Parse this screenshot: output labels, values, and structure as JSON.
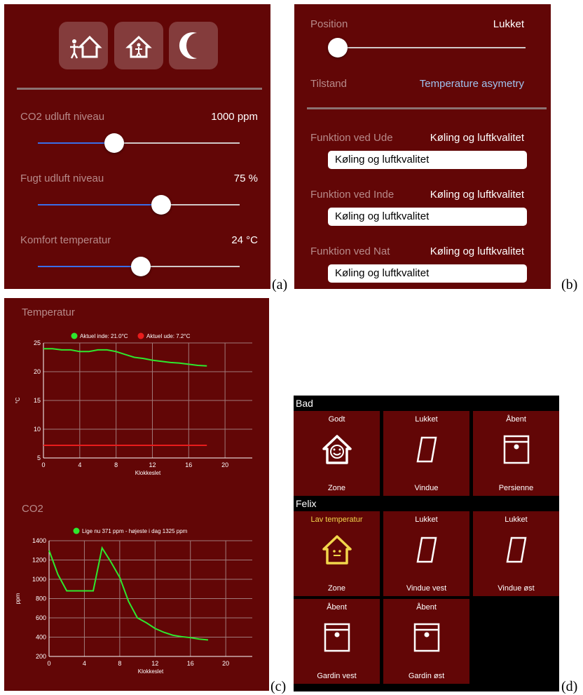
{
  "captions": {
    "a": "(a)",
    "b": "(b)",
    "c": "(c)",
    "d": "(d)"
  },
  "panel_a": {
    "mode_buttons": [
      {
        "icon": "person-house-icon"
      },
      {
        "icon": "person-inside-house-icon"
      },
      {
        "icon": "crescent-moon-icon"
      }
    ],
    "rows": [
      {
        "label": "CO2 udluft niveau",
        "value": "1000 ppm",
        "level": 0.38
      },
      {
        "label": "Fugt udluft niveau",
        "value": "75 %",
        "level": 0.61
      },
      {
        "label": "Komfort temperatur",
        "value": "24 °C",
        "level": 0.51
      }
    ]
  },
  "panel_b": {
    "position_label": "Position",
    "position_value": "Lukket",
    "position_level": 0.0,
    "state_label": "Tilstand",
    "state_value": "Temperature asymetry",
    "functions": [
      {
        "label": "Funktion ved Ude",
        "value": "Køling og luftkvalitet",
        "select": "Køling og luftkvalitet"
      },
      {
        "label": "Funktion ved Inde",
        "value": "Køling og luftkvalitet",
        "select": "Køling og luftkvalitet"
      },
      {
        "label": "Funktion ved Nat",
        "value": "Køling og luftkvalitet",
        "select": "Køling og luftkvalitet"
      }
    ]
  },
  "panel_c": {
    "temp_title": "Temperatur",
    "co2_title": "CO2",
    "colors": {
      "indoor": "#2ee82e",
      "outdoor": "#e81c1c",
      "grid": "#a07a7a",
      "axis": "#ffffff"
    }
  },
  "chart_data": [
    {
      "type": "line",
      "title": "Temperatur",
      "xlabel": "Klokkeslet",
      "ylabel": "°C",
      "xlim": [
        0,
        23
      ],
      "ylim": [
        5,
        25
      ],
      "xticks": [
        0,
        4,
        8,
        12,
        16,
        20
      ],
      "yticks": [
        5,
        10,
        15,
        20,
        25
      ],
      "grid": true,
      "legend_position": "top",
      "series": [
        {
          "name": "Aktuel inde: 21.0°C",
          "color": "#2ee82e",
          "x": [
            0,
            1,
            2,
            3,
            4,
            5,
            6,
            7,
            8,
            9,
            10,
            11,
            12,
            13,
            14,
            15,
            16,
            17,
            18
          ],
          "y": [
            24.0,
            24.0,
            23.8,
            23.8,
            23.5,
            23.5,
            23.8,
            23.8,
            23.5,
            23.0,
            22.5,
            22.3,
            22.0,
            21.8,
            21.6,
            21.5,
            21.3,
            21.1,
            21.0
          ]
        },
        {
          "name": "Aktuel ude: 7.2°C",
          "color": "#e81c1c",
          "x": [
            0,
            18
          ],
          "y": [
            7.2,
            7.2
          ]
        }
      ]
    },
    {
      "type": "line",
      "title": "CO2",
      "xlabel": "Klokkeslet",
      "ylabel": "ppm",
      "xlim": [
        0,
        23
      ],
      "ylim": [
        200,
        1400
      ],
      "xticks": [
        0,
        4,
        8,
        12,
        16,
        20
      ],
      "yticks": [
        200,
        400,
        600,
        800,
        1000,
        1200,
        1400
      ],
      "grid": true,
      "legend_position": "top",
      "series": [
        {
          "name": "Lige nu 371 ppm - højeste i dag 1325 ppm",
          "color": "#2ee82e",
          "x": [
            0,
            1,
            2,
            3,
            4,
            5,
            6,
            7,
            8,
            9,
            10,
            11,
            12,
            13,
            14,
            15,
            16,
            17,
            18
          ],
          "y": [
            1300,
            1050,
            880,
            880,
            880,
            880,
            1325,
            1180,
            1020,
            770,
            600,
            550,
            490,
            450,
            420,
            405,
            395,
            380,
            371
          ]
        }
      ]
    }
  ],
  "panel_d": {
    "sections": [
      {
        "name": "Bad",
        "tiles": [
          {
            "status": "Godt",
            "name": "Zone",
            "icon": "smiling-house-icon",
            "status_color": "#ffffff"
          },
          {
            "status": "Lukket",
            "name": "Vindue",
            "icon": "window-icon",
            "status_color": "#ffffff"
          },
          {
            "status": "Åbent",
            "name": "Persienne",
            "icon": "blind-icon",
            "status_color": "#ffffff"
          }
        ]
      },
      {
        "name": "Felix",
        "tiles": [
          {
            "status": "Lav temperatur",
            "name": "Zone",
            "icon": "neutral-house-icon",
            "status_color": "#f2d64b"
          },
          {
            "status": "Lukket",
            "name": "Vindue vest",
            "icon": "window-icon",
            "status_color": "#ffffff"
          },
          {
            "status": "Lukket",
            "name": "Vindue øst",
            "icon": "window-icon",
            "status_color": "#ffffff"
          },
          {
            "status": "Åbent",
            "name": "Gardin vest",
            "icon": "blind-icon",
            "status_color": "#ffffff"
          },
          {
            "status": "Åbent",
            "name": "Gardin øst",
            "icon": "blind-icon",
            "status_color": "#ffffff"
          }
        ]
      }
    ]
  }
}
